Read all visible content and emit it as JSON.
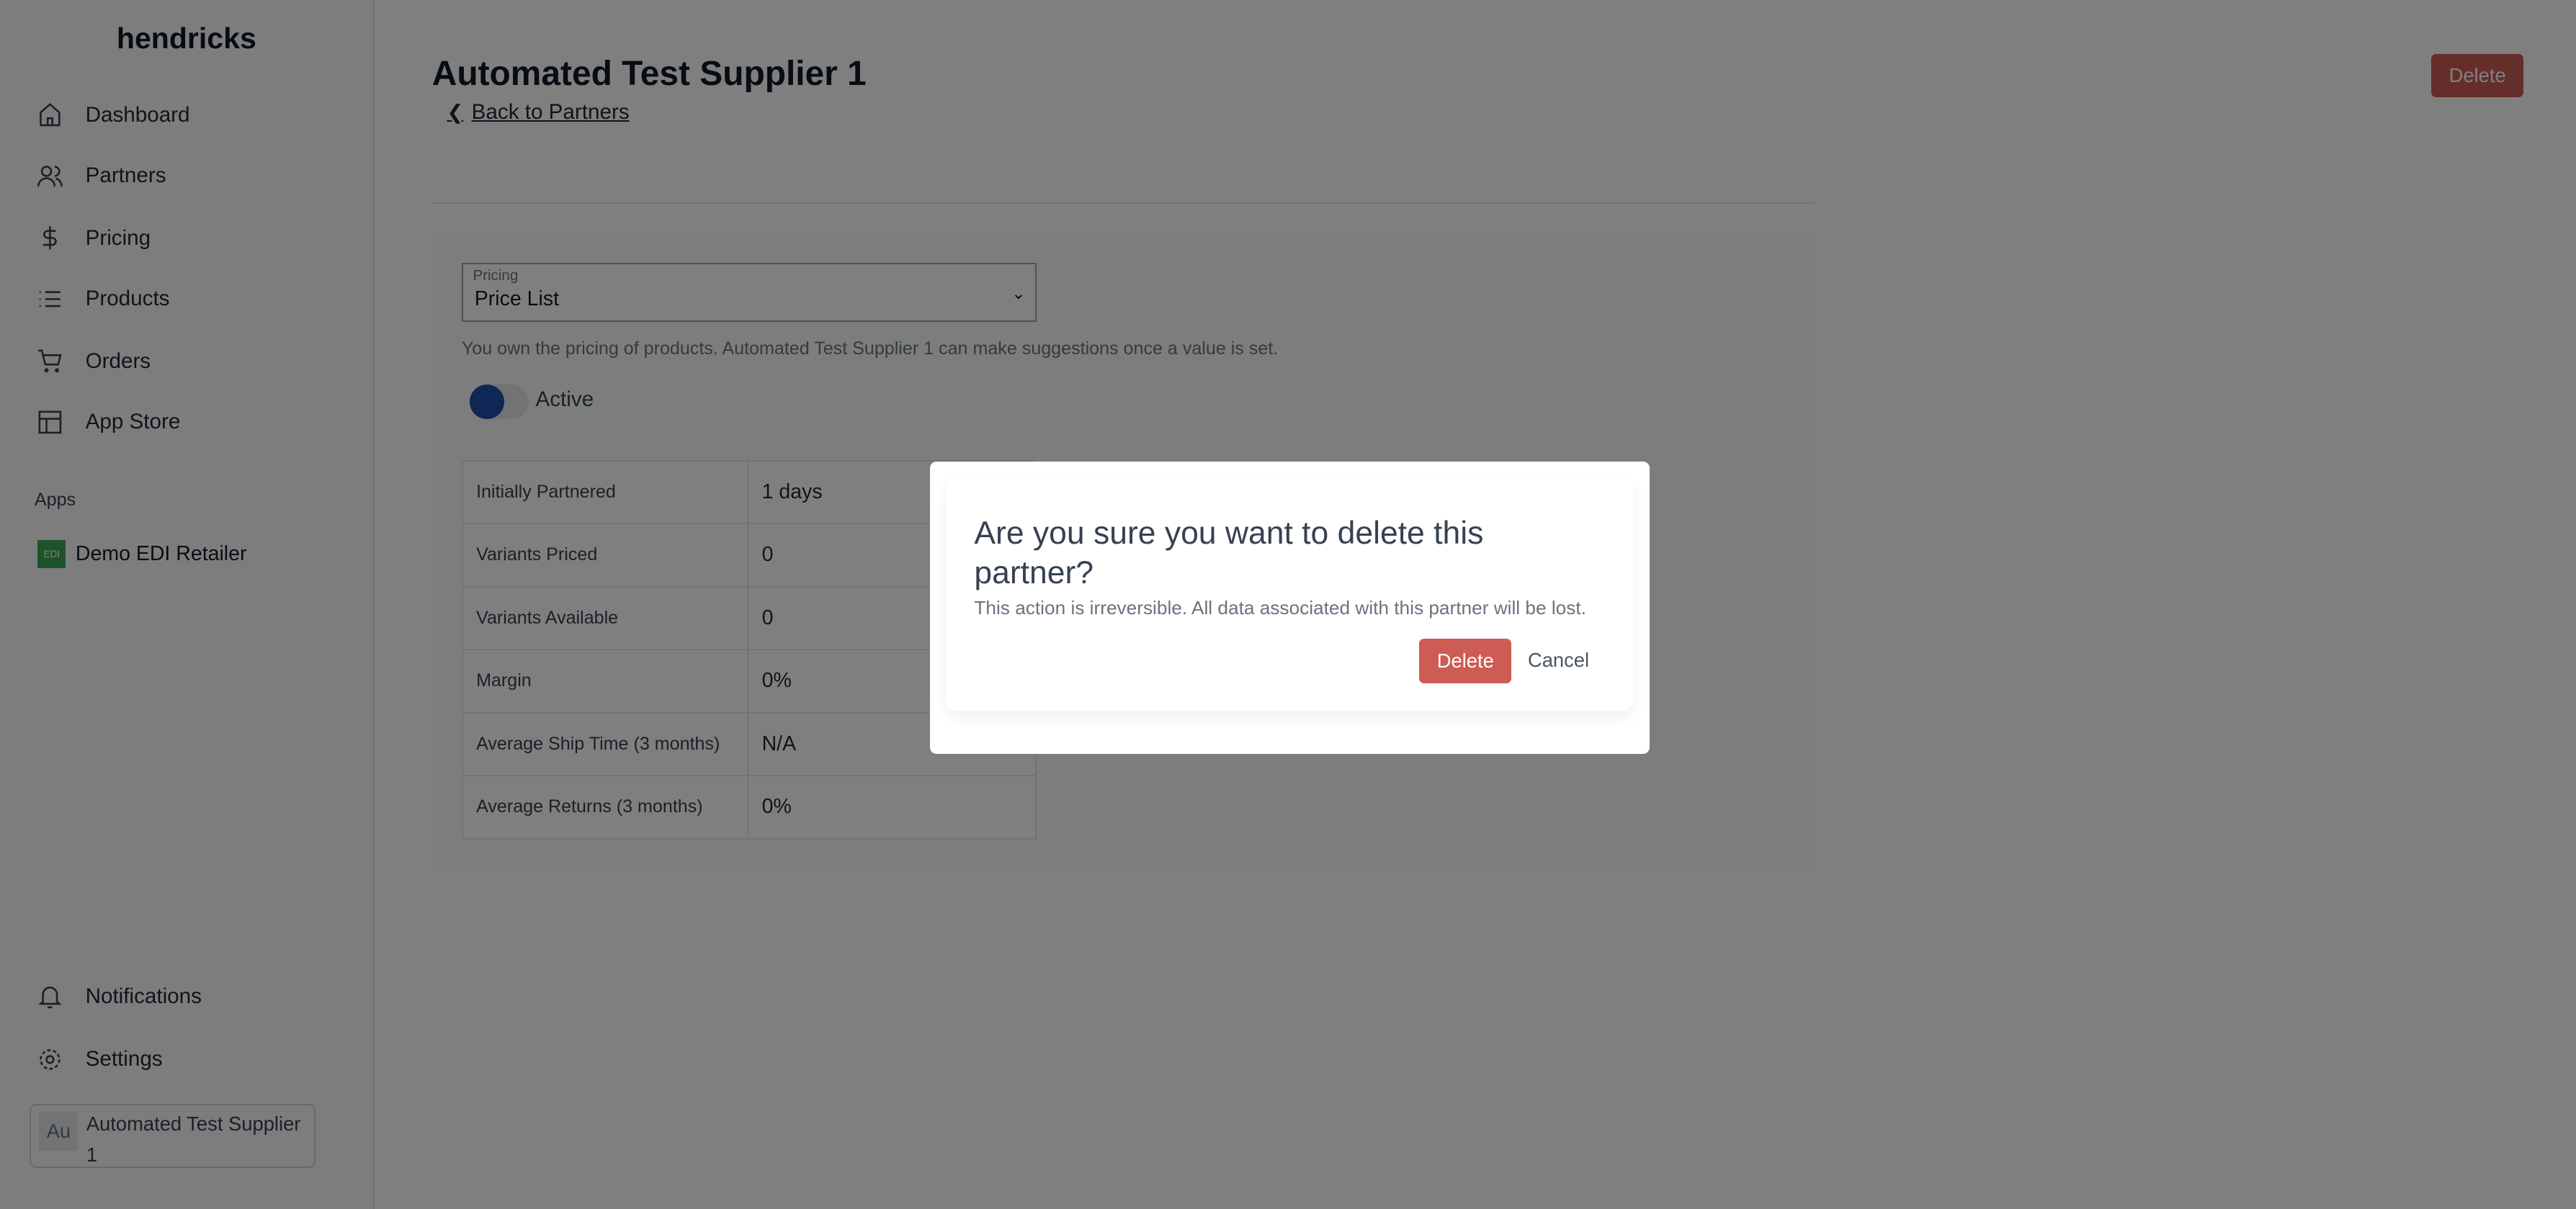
{
  "sidebar": {
    "logo": "hendricks",
    "items": [
      {
        "label": "Dashboard",
        "icon": "home-icon"
      },
      {
        "label": "Partners",
        "icon": "users-icon"
      },
      {
        "label": "Pricing",
        "icon": "dollar-icon"
      },
      {
        "label": "Products",
        "icon": "list-icon"
      },
      {
        "label": "Orders",
        "icon": "cart-icon"
      },
      {
        "label": "App Store",
        "icon": "layout-icon"
      }
    ],
    "apps_label": "Apps",
    "apps": [
      {
        "badge": "EDI",
        "label": "Demo EDI Retailer"
      }
    ],
    "notifications": "Notifications",
    "settings": "Settings",
    "account": {
      "initials": "Au",
      "name": "Automated Test Supplier 1"
    }
  },
  "header": {
    "title": "Automated Test Supplier 1",
    "back": "Back to Partners",
    "delete": "Delete"
  },
  "pricing": {
    "label": "Pricing",
    "value": "Price List",
    "helper": "You own the pricing of products. Automated Test Supplier 1 can make suggestions once a value is set.",
    "toggle_label": "Active",
    "toggle_on": true
  },
  "stats": [
    {
      "label": "Initially Partnered",
      "value": "1 days"
    },
    {
      "label": "Variants Priced",
      "value": "0"
    },
    {
      "label": "Variants Available",
      "value": "0"
    },
    {
      "label": "Margin",
      "value": "0%"
    },
    {
      "label": "Average Ship Time (3 months)",
      "value": "N/A"
    },
    {
      "label": "Average Returns (3 months)",
      "value": "0%"
    }
  ],
  "modal": {
    "title": "Are you sure you want to delete this partner?",
    "text": "This action is irreversible. All data associated with this partner will be lost.",
    "delete": "Delete",
    "cancel": "Cancel"
  },
  "colors": {
    "danger": "#cd5c55",
    "toggle": "#1e4fa8"
  }
}
